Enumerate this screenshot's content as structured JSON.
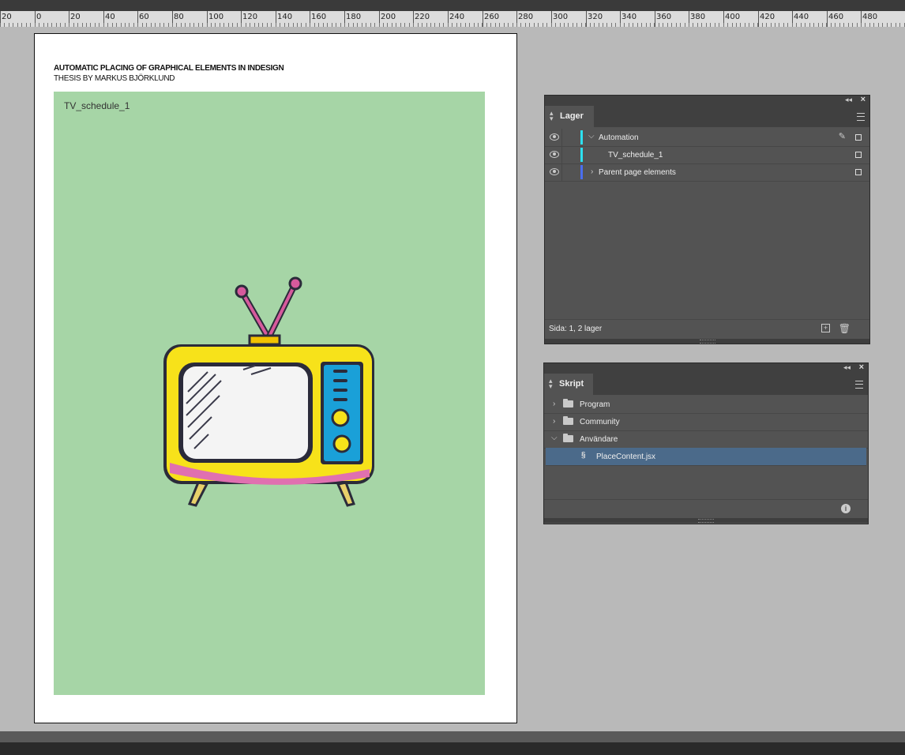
{
  "ruler": {
    "labels": [
      "20",
      "0",
      "20",
      "40",
      "60",
      "80",
      "100",
      "120",
      "140",
      "160",
      "180",
      "200",
      "220",
      "240",
      "260",
      "280",
      "300",
      "320",
      "340",
      "360",
      "380",
      "400",
      "420",
      "440",
      "460",
      "480"
    ]
  },
  "document": {
    "title": "AUTOMATIC PLACING OF GRAPHICAL ELEMENTS IN INDESIGN",
    "subtitle": "THESIS BY MARKUS BJÖRKLUND",
    "frame_label": "TV_schedule_1",
    "frame_color": "#a6d5a6"
  },
  "layers_panel": {
    "tab_label": "Lager",
    "layers": [
      {
        "name": "Automation",
        "color": "#2de0f0",
        "expanded": true
      },
      {
        "name": "TV_schedule_1",
        "color": "#2de0f0"
      },
      {
        "name": "Parent page elements",
        "color": "#4a6ef0",
        "expanded": false
      }
    ],
    "status": "Sida: 1, 2 lager"
  },
  "scripts_panel": {
    "tab_label": "Skript",
    "folders": [
      {
        "name": "Program",
        "expanded": false
      },
      {
        "name": "Community",
        "expanded": false
      },
      {
        "name": "Användare",
        "expanded": true
      }
    ],
    "selected_script": "PlaceContent.jsx",
    "selection_color": "#4b6a8a"
  }
}
